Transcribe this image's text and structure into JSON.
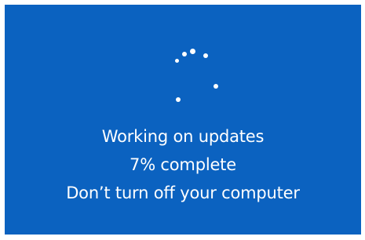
{
  "colors": {
    "background": "#0b62c0",
    "text": "#ffffff",
    "spinner_dot": "#ffffff"
  },
  "spinner": {
    "icon": "loading-dots-icon"
  },
  "messages": {
    "title": "Working on updates",
    "progress": "7% complete",
    "warning": "Don’t turn off your computer"
  },
  "progress_percent": 7
}
